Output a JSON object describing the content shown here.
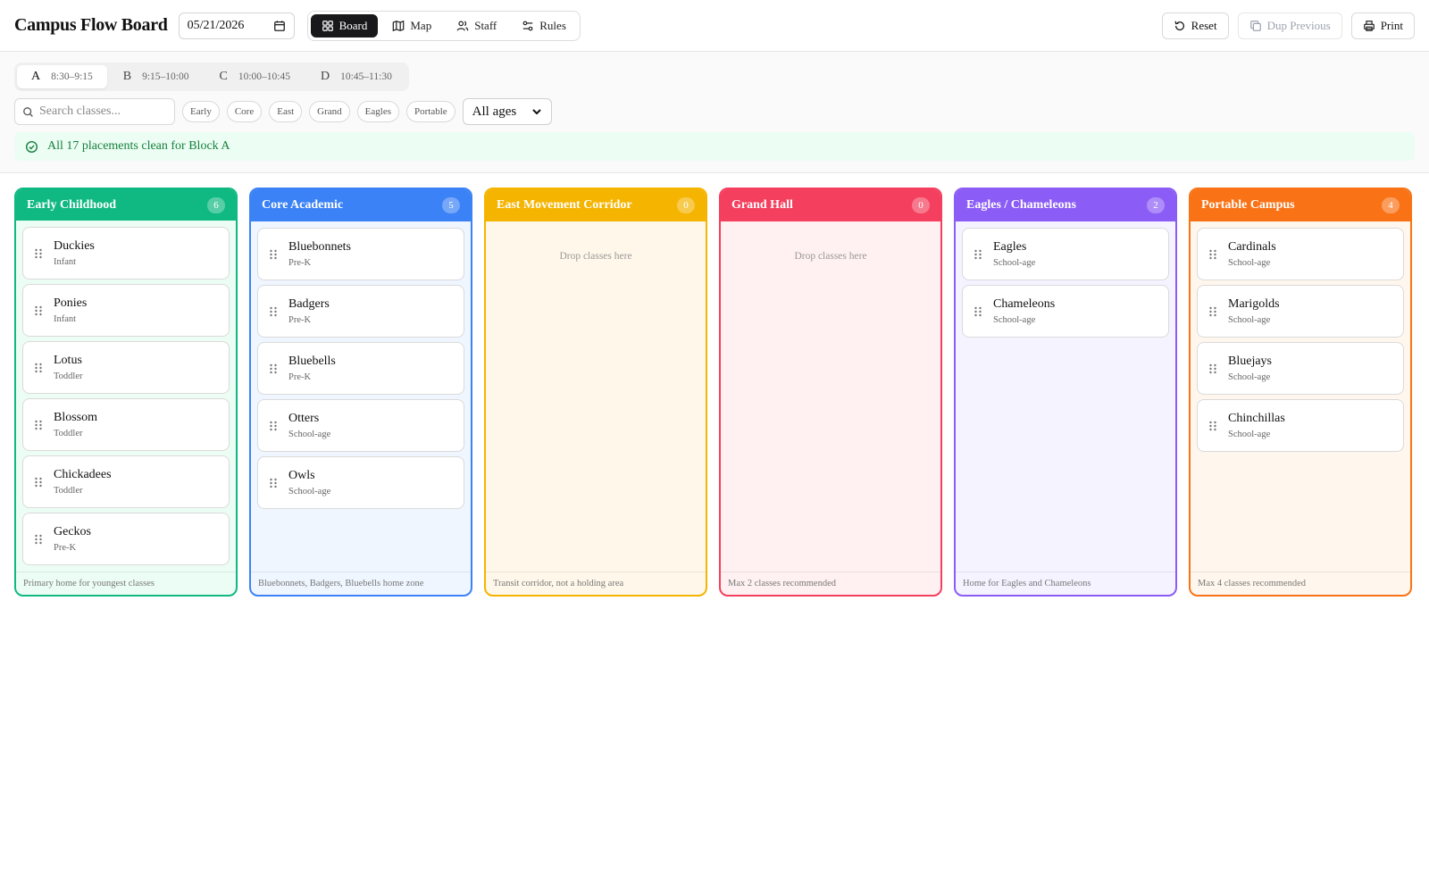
{
  "header": {
    "title": "Campus Flow Board",
    "date": "05/21/2026",
    "tabs": [
      {
        "label": "Board",
        "icon": "grid-icon",
        "active": true
      },
      {
        "label": "Map",
        "icon": "map-icon",
        "active": false
      },
      {
        "label": "Staff",
        "icon": "users-icon",
        "active": false
      },
      {
        "label": "Rules",
        "icon": "sliders-icon",
        "active": false
      }
    ],
    "actions": {
      "reset": "Reset",
      "dup_previous": "Dup Previous",
      "print": "Print"
    }
  },
  "blocks": [
    {
      "letter": "A",
      "time": "8:30–9:15",
      "active": true
    },
    {
      "letter": "B",
      "time": "9:15–10:00",
      "active": false
    },
    {
      "letter": "C",
      "time": "10:00–10:45",
      "active": false
    },
    {
      "letter": "D",
      "time": "10:45–11:30",
      "active": false
    }
  ],
  "filters": {
    "search_placeholder": "Search classes...",
    "chips": [
      "Early",
      "Core",
      "East",
      "Grand",
      "Eagles",
      "Portable"
    ],
    "age_select": "All ages"
  },
  "status": {
    "text": "All 17 placements clean for Block A",
    "color": "#15803d"
  },
  "zones": [
    {
      "name": "Early Childhood",
      "count": "6",
      "color": "#10b981",
      "bg": "#ecfdf5",
      "footer": "Primary home for youngest classes",
      "classes": [
        {
          "name": "Duckies",
          "age": "Infant"
        },
        {
          "name": "Ponies",
          "age": "Infant"
        },
        {
          "name": "Lotus",
          "age": "Toddler"
        },
        {
          "name": "Blossom",
          "age": "Toddler"
        },
        {
          "name": "Chickadees",
          "age": "Toddler"
        },
        {
          "name": "Geckos",
          "age": "Pre-K"
        }
      ]
    },
    {
      "name": "Core Academic",
      "count": "5",
      "color": "#3b82f6",
      "bg": "#eff6ff",
      "footer": "Bluebonnets, Badgers, Bluebells home zone",
      "classes": [
        {
          "name": "Bluebonnets",
          "age": "Pre-K"
        },
        {
          "name": "Badgers",
          "age": "Pre-K"
        },
        {
          "name": "Bluebells",
          "age": "Pre-K"
        },
        {
          "name": "Otters",
          "age": "School-age"
        },
        {
          "name": "Owls",
          "age": "School-age"
        }
      ]
    },
    {
      "name": "East Movement Corridor",
      "count": "0",
      "color": "#f5b400",
      "bg": "#fff8ea",
      "footer": "Transit corridor, not a holding area",
      "empty_hint": "Drop classes here",
      "classes": []
    },
    {
      "name": "Grand Hall",
      "count": "0",
      "color": "#f43f5e",
      "bg": "#fff1f2",
      "footer": "Max 2 classes recommended",
      "empty_hint": "Drop classes here",
      "classes": []
    },
    {
      "name": "Eagles / Chameleons",
      "count": "2",
      "color": "#8b5cf6",
      "bg": "#f5f3ff",
      "footer": "Home for Eagles and Chameleons",
      "classes": [
        {
          "name": "Eagles",
          "age": "School-age"
        },
        {
          "name": "Chameleons",
          "age": "School-age"
        }
      ]
    },
    {
      "name": "Portable Campus",
      "count": "4",
      "color": "#f97316",
      "bg": "#fff7ed",
      "footer": "Max 4 classes recommended",
      "classes": [
        {
          "name": "Cardinals",
          "age": "School-age"
        },
        {
          "name": "Marigolds",
          "age": "School-age"
        },
        {
          "name": "Bluejays",
          "age": "School-age"
        },
        {
          "name": "Chinchillas",
          "age": "School-age"
        }
      ]
    }
  ]
}
